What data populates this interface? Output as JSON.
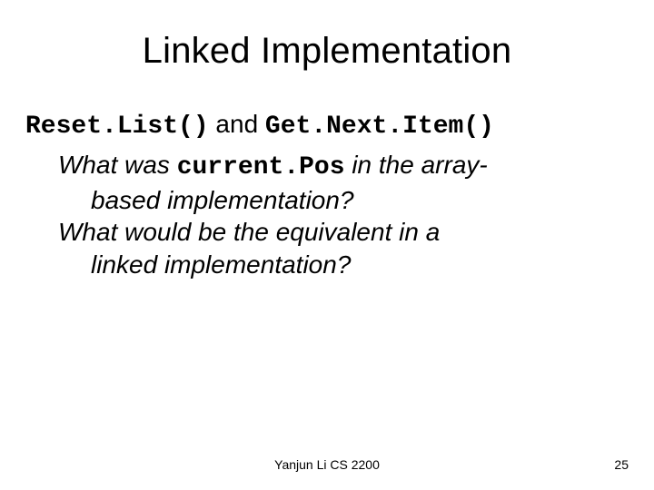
{
  "title": "Linked Implementation",
  "line1": {
    "fn1": "Reset.List()",
    "mid": " and ",
    "fn2": "Get.Next.Item()"
  },
  "q1": {
    "pre": "What was ",
    "code": "current.Pos",
    "post": " in the array-",
    "line2": "based implementation?"
  },
  "q2": {
    "line1": "What would be the equivalent in a",
    "line2": "linked implementation?"
  },
  "footer": {
    "center": "Yanjun Li CS 2200",
    "page": "25"
  }
}
